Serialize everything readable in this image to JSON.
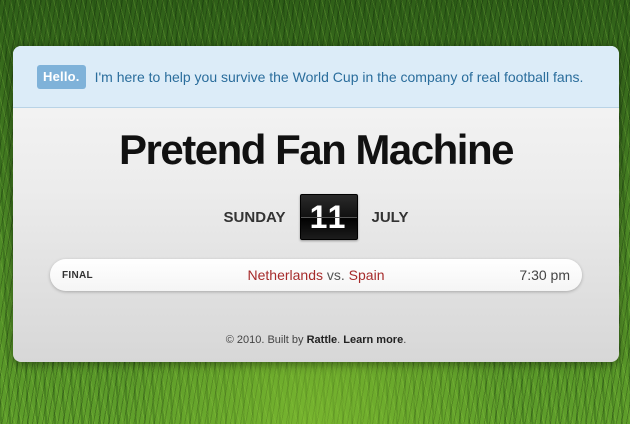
{
  "intro": {
    "badge": "Hello.",
    "message": "I'm here to help you survive the World Cup in the company of real football fans."
  },
  "title": "Pretend Fan Machine",
  "date": {
    "weekday": "SUNDAY",
    "day": "11",
    "month": "JULY"
  },
  "match": {
    "status": "FINAL",
    "home_team": "Netherlands",
    "separator": "vs.",
    "away_team": "Spain",
    "time": "7:30 pm"
  },
  "footer": {
    "prefix": "© 2010. Built by",
    "brand": "Rattle",
    "link": "Learn more"
  },
  "colors": {
    "intro_background": "#dcecf8",
    "badge_background": "#7fb2d9",
    "intro_text": "#2a6d9c",
    "team_text": "#a62b2b",
    "title_text": "#111111"
  }
}
